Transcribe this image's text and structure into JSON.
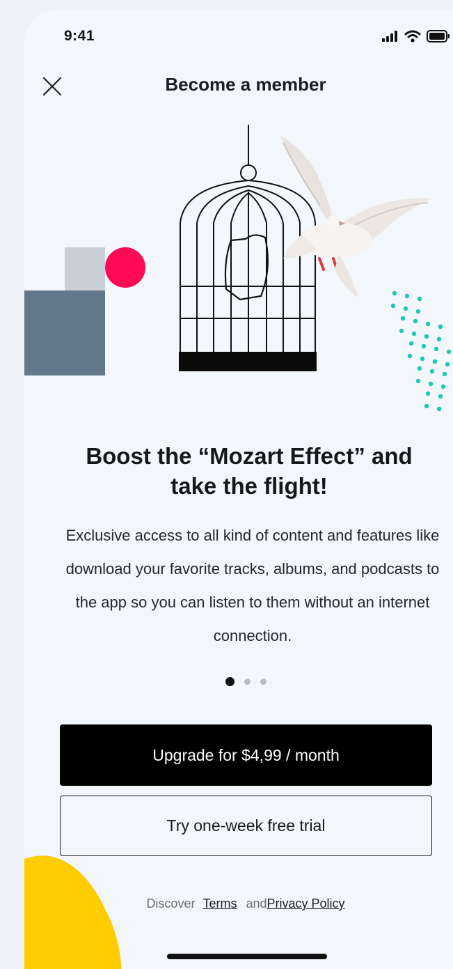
{
  "status_bar": {
    "time": "9:41"
  },
  "header": {
    "title": "Become a member",
    "close_icon": "close-icon"
  },
  "content": {
    "headline_line1": "Boost the “Mozart Effect” and",
    "headline_line2": "take the flight!",
    "description": "Exclusive access to all kind of content and features like download your favorite tracks, albums, and podcasts to the app so you can listen to them without an internet connection."
  },
  "pagination": {
    "current": 1,
    "total": 3
  },
  "actions": {
    "upgrade_label": "Upgrade for $4,99 / month",
    "trial_label": "Try one-week free trial"
  },
  "legal": {
    "prefix": "Discover",
    "terms_label": "Terms",
    "joiner": "and",
    "privacy_label": "Privacy Policy"
  },
  "colors": {
    "accent_pink": "#ff0a55",
    "teal_dots": "#1ec7b6",
    "yellow_blob": "#ffcc00",
    "slate": "#63788a",
    "primary_button": "#000000"
  }
}
